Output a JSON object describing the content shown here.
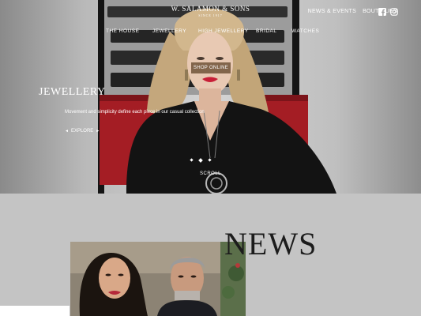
{
  "brand": {
    "name": "W. SALAMON & SONS",
    "since": "SINCE 1917"
  },
  "topnav": {
    "news_events": "NEWS & EVENTS",
    "boutiques": "BOUTIQUES"
  },
  "mainnav": [
    "THE HOUSE",
    "JEWELLERY",
    "HIGH JEWELLERY",
    "BRIDAL",
    "WATCHES"
  ],
  "hero": {
    "shop_label": "SHOP ONLINE",
    "title": "JEWELLERY",
    "subtitle": "Movement and simplicity define each piece in our casual collection",
    "explore_label": "EXPLORE",
    "scroll_label": "SCROLL",
    "slides_total": 3,
    "active_slide": 2
  },
  "news": {
    "title": "NEWS"
  },
  "icons": {
    "social": [
      "facebook-icon",
      "instagram-icon"
    ]
  },
  "colors": {
    "shop_button": "#705438",
    "chair_red": "#a41d24",
    "section_bg": "#c4c4c4"
  }
}
